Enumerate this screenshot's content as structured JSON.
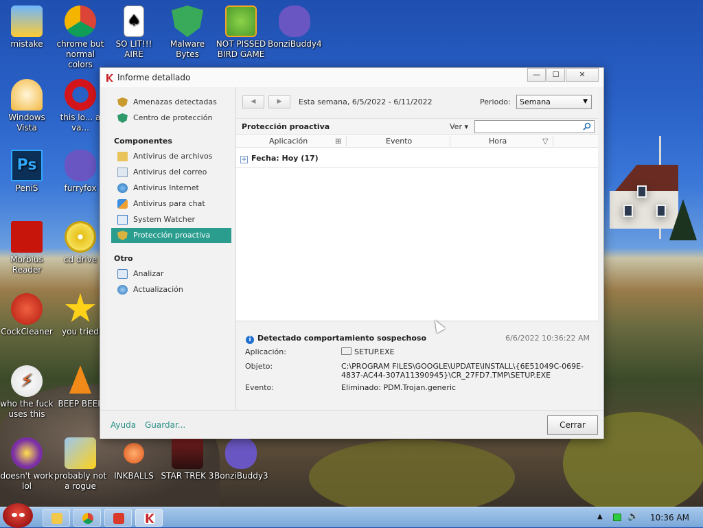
{
  "desktop": {
    "icons": [
      {
        "label": "mistake"
      },
      {
        "label": "chrome but normal colors"
      },
      {
        "label": "SO LIT!!! AIRE"
      },
      {
        "label": "Malware Bytes"
      },
      {
        "label": "NOT PISSED BIRD GAME"
      },
      {
        "label": "BonziBuddy4"
      },
      {
        "label": "Windows Vista"
      },
      {
        "label": "this lo... a va..."
      },
      {
        "label": "PeniS"
      },
      {
        "label": "furryfox"
      },
      {
        "label": "Morbius Reader"
      },
      {
        "label": "cd drive"
      },
      {
        "label": "CockCleaner"
      },
      {
        "label": "you tried"
      },
      {
        "label": "who the fuck uses this"
      },
      {
        "label": "BEEP BEEP"
      },
      {
        "label": "doesn't work lol"
      },
      {
        "label": "probably not a rogue"
      },
      {
        "label": "INKBALLS"
      },
      {
        "label": "STAR TREK 3"
      },
      {
        "label": "BonziBuddy3"
      }
    ]
  },
  "window": {
    "title": "Informe detallado",
    "controls": {
      "minimize": "—",
      "maximize": "☐",
      "close": "✕"
    }
  },
  "sidebar": {
    "top_items": [
      {
        "label": "Amenazas detectadas",
        "icon": "shield-orange-icon"
      },
      {
        "label": "Centro de protección",
        "icon": "shield-green-icon"
      }
    ],
    "components_header": "Componentes",
    "components": [
      {
        "label": "Antivirus de archivos",
        "icon": "folder-icon"
      },
      {
        "label": "Antivirus del correo",
        "icon": "mail-icon"
      },
      {
        "label": "Antivirus Internet",
        "icon": "globe-icon"
      },
      {
        "label": "Antivirus para chat",
        "icon": "chat-icon"
      },
      {
        "label": "System Watcher",
        "icon": "monitor-icon"
      },
      {
        "label": "Protección proactiva",
        "icon": "shield-icon",
        "selected": true
      }
    ],
    "other_header": "Otro",
    "other": [
      {
        "label": "Analizar",
        "icon": "scan-icon"
      },
      {
        "label": "Actualización",
        "icon": "update-icon"
      }
    ]
  },
  "toolbar": {
    "back": "◀",
    "forward": "▶",
    "date_range": "Esta semana, 6/5/2022 - 6/11/2022",
    "period_label": "Periodo:",
    "period_value": "Semana",
    "period_arrow": "▼"
  },
  "section": {
    "title": "Protección proactiva",
    "view_label": "Ver ▾",
    "search_placeholder": ""
  },
  "table": {
    "columns": [
      "Aplicación",
      "Evento",
      "Hora"
    ],
    "add_column_icon": "⊞",
    "sort_icon": "▽",
    "group": {
      "expander": "+",
      "label": "Fecha: Hoy (17)"
    }
  },
  "details": {
    "info_glyph": "i",
    "heading": "Detectado comportamiento sospechoso",
    "timestamp": "6/6/2022 10:36:22 AM",
    "fields": [
      {
        "label": "Aplicación:",
        "value": "SETUP.EXE"
      },
      {
        "label": "Objeto:",
        "value": "C:\\PROGRAM FILES\\GOOGLE\\UPDATE\\INSTALL\\{6E51049C-069E-4837-AC44-307A11390945}\\CR_27FD7.TMP\\SETUP.EXE"
      },
      {
        "label": "Evento:",
        "value": "Eliminado: PDM.Trojan.generic"
      }
    ]
  },
  "footer": {
    "help": "Ayuda",
    "save": "Guardar...",
    "close_button": "Cerrar"
  },
  "taskbar": {
    "clock": "10:36 AM",
    "tray_arrow": "▲",
    "volume": "🔊"
  },
  "colors": {
    "accent": "#2a9d8f",
    "link": "#2a8f86",
    "info": "#1f6fd0"
  }
}
